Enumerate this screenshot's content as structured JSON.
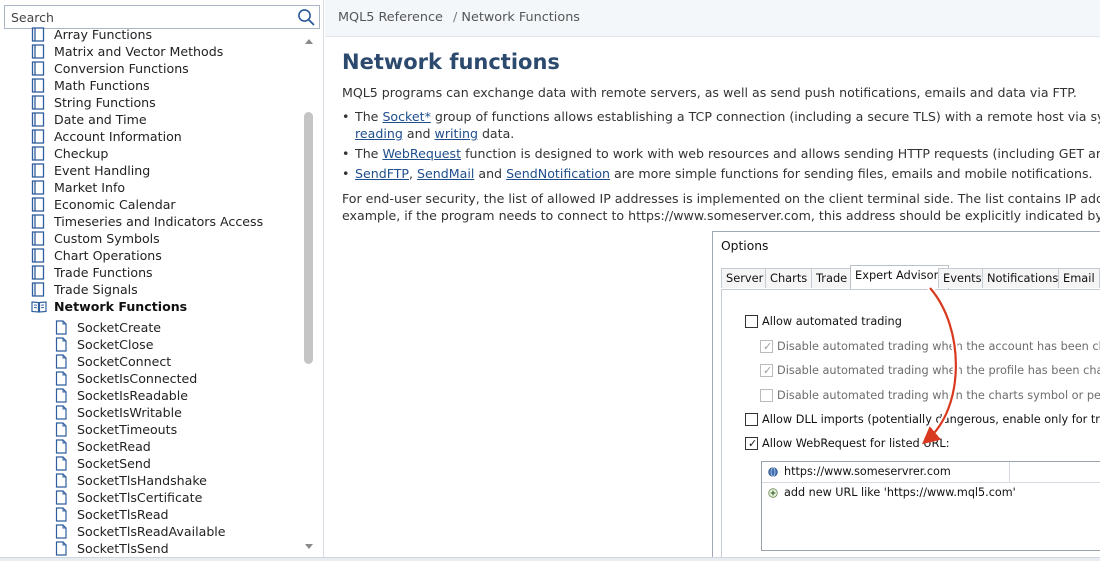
{
  "search": {
    "placeholder": "Search"
  },
  "sidebar": {
    "items": [
      {
        "label": "Array Functions"
      },
      {
        "label": "Matrix and Vector Methods"
      },
      {
        "label": "Conversion Functions"
      },
      {
        "label": "Math Functions"
      },
      {
        "label": "String Functions"
      },
      {
        "label": "Date and Time"
      },
      {
        "label": "Account Information"
      },
      {
        "label": "Checkup"
      },
      {
        "label": "Event Handling"
      },
      {
        "label": "Market Info"
      },
      {
        "label": "Economic Calendar"
      },
      {
        "label": "Timeseries and Indicators Access"
      },
      {
        "label": "Custom Symbols"
      },
      {
        "label": "Chart Operations"
      },
      {
        "label": "Trade Functions"
      },
      {
        "label": "Trade Signals"
      },
      {
        "label": "Network Functions"
      }
    ],
    "subitems": [
      {
        "label": "SocketCreate"
      },
      {
        "label": "SocketClose"
      },
      {
        "label": "SocketConnect"
      },
      {
        "label": "SocketIsConnected"
      },
      {
        "label": "SocketIsReadable"
      },
      {
        "label": "SocketIsWritable"
      },
      {
        "label": "SocketTimeouts"
      },
      {
        "label": "SocketRead"
      },
      {
        "label": "SocketSend"
      },
      {
        "label": "SocketTlsHandshake"
      },
      {
        "label": "SocketTlsCertificate"
      },
      {
        "label": "SocketTlsRead"
      },
      {
        "label": "SocketTlsReadAvailable"
      },
      {
        "label": "SocketTlsSend"
      }
    ]
  },
  "breadcrumb": {
    "root": "MQL5 Reference",
    "separator": "/",
    "current": "Network Functions"
  },
  "main": {
    "title": "Network functions",
    "intro": "MQL5 programs can exchange data with remote servers, as well as send push notifications, emails and data via FTP.",
    "b1": {
      "pre": "The ",
      "link1": "Socket*",
      "mid": " group of functions allows establishing a TCP connection (including a secure TLS) with a remote host via system sockets. The operation principle is simple: ",
      "link2": "reading",
      "and": " and ",
      "link3": "writing",
      "post": " data."
    },
    "b2": {
      "pre": "The ",
      "link1": "WebRequest",
      "post": " function is designed to work with web resources and allows sending HTTP requests (including GET and POST) easily."
    },
    "b3": {
      "link1": "SendFTP",
      "comma": ", ",
      "link2": "SendMail",
      "and": " and ",
      "link3": "SendNotification",
      "post": " are more simple functions for sending files, emails and mobile notifications."
    },
    "security1": "For end-user security, the list of allowed IP addresses is implemented on the client terminal side. The list contains IP addresses the MQL5 program is allowed to connect to via the Socket* and WebRequest() functions. For",
    "security2": "example, if the program needs to connect to https://www.someserver.com, this address should be explicitly indicated by a terminal user in the list."
  },
  "dialog": {
    "title": "Options",
    "tabs": [
      "Server",
      "Charts",
      "Trade",
      "Expert Advisors",
      "Events",
      "Notifications",
      "Email"
    ],
    "selected_tab": "Expert Advisors",
    "options": [
      {
        "label": "Allow automated trading",
        "checked": false,
        "disabled": false
      },
      {
        "label": "Disable automated trading when the account has been changed",
        "checked": true,
        "disabled": true
      },
      {
        "label": "Disable automated trading when the profile has been changed",
        "checked": true,
        "disabled": true
      },
      {
        "label": "Disable automated trading when the charts symbol or period has been changed",
        "checked": false,
        "disabled": true
      },
      {
        "label": "Allow DLL imports (potentially dangerous, enable only for trusted applications)",
        "checked": false,
        "disabled": false
      },
      {
        "label": "Allow WebRequest for listed URL:",
        "checked": true,
        "disabled": false
      }
    ],
    "url_list": {
      "entry": "https://www.someservrer.com",
      "add_hint": "add new URL like 'https://www.mql5.com'"
    }
  },
  "colors": {
    "title": "#2c4a6e",
    "link": "#1f4e8c",
    "arrow": "#d93a1f",
    "header_bg": "#f4f7fa"
  }
}
